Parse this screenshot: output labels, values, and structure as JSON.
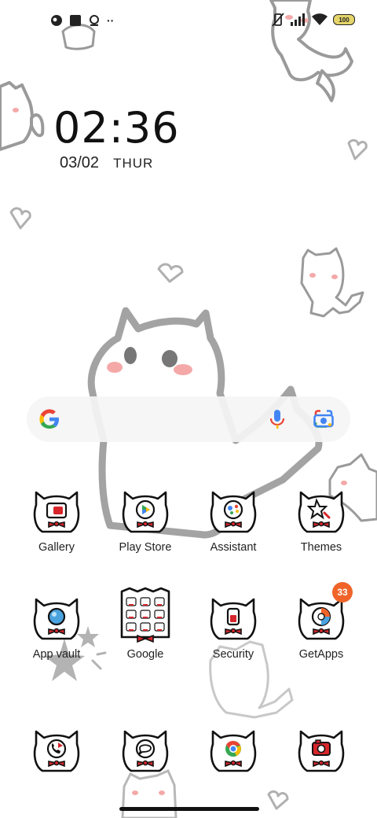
{
  "status_bar": {
    "left_icons": [
      "reader-icon",
      "square-icon",
      "location-icon",
      "more-icon"
    ],
    "more_text": "··",
    "right_icons": [
      "vibrate-icon",
      "signal-icon",
      "wifi-icon"
    ],
    "battery": "100"
  },
  "clock": {
    "time": "02:36",
    "date": "03/02",
    "day": "THUR"
  },
  "search": {
    "icons": [
      "google-icon",
      "mic-icon",
      "lens-icon"
    ]
  },
  "apps": {
    "row1": [
      {
        "label": "Gallery",
        "icon": "gallery-icon"
      },
      {
        "label": "Play Store",
        "icon": "play-store-icon"
      },
      {
        "label": "Assistant",
        "icon": "assistant-icon"
      },
      {
        "label": "Themes",
        "icon": "themes-icon"
      }
    ],
    "row2": [
      {
        "label": "App vault",
        "icon": "app-vault-icon"
      },
      {
        "label": "Google",
        "icon": "google-folder-icon"
      },
      {
        "label": "Security",
        "icon": "security-icon"
      },
      {
        "label": "GetApps",
        "icon": "getapps-icon",
        "badge": "33"
      }
    ],
    "dock": [
      {
        "icon": "phone-icon"
      },
      {
        "icon": "messages-icon"
      },
      {
        "icon": "chrome-icon"
      },
      {
        "icon": "camera-icon"
      }
    ]
  },
  "colors": {
    "badge": "#f0642a",
    "bowtie": "#d6262b",
    "cat_outline": "#9a9a9a",
    "blush": "#f4a9a8"
  }
}
